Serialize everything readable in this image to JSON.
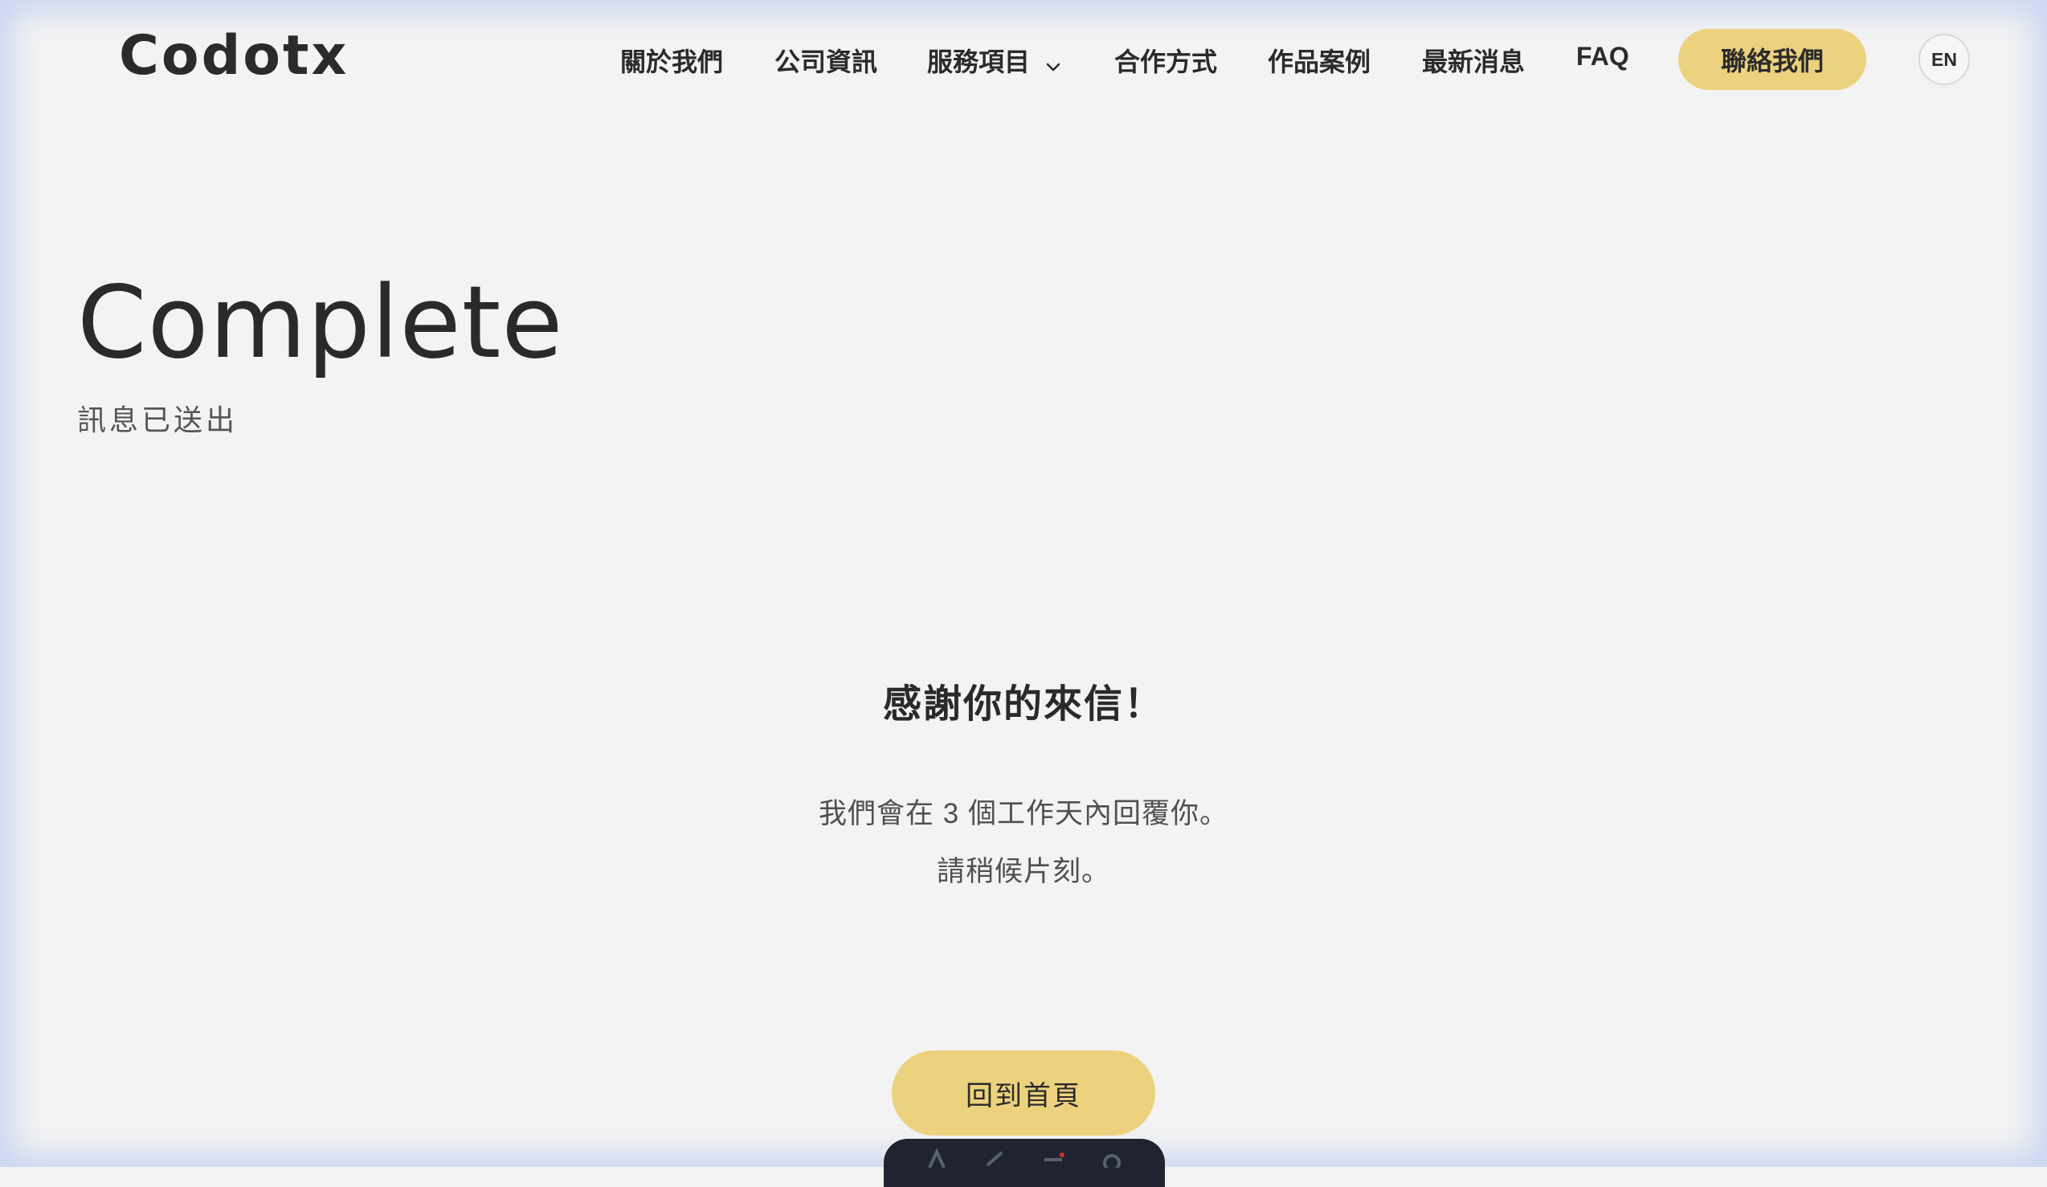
{
  "header": {
    "logo": "Codotx",
    "nav": [
      {
        "label": "關於我們"
      },
      {
        "label": "公司資訊"
      },
      {
        "label": "服務項目",
        "has_dropdown": true
      },
      {
        "label": "合作方式"
      },
      {
        "label": "作品案例"
      },
      {
        "label": "最新消息"
      },
      {
        "label": "FAQ"
      }
    ],
    "contact_label": "聯絡我們",
    "lang_label": "EN"
  },
  "hero": {
    "title": "Complete",
    "subtitle": "訊息已送出"
  },
  "main": {
    "thanks": "感謝你的來信！",
    "line1": "我們會在 3 個工作天內回覆你。",
    "line2": "請稍候片刻。",
    "home_button": "回到首頁"
  },
  "colors": {
    "background": "#f3f3f3",
    "accent": "#ecd27e",
    "text": "#2a2a2a",
    "dock": "#1f2430"
  },
  "icons": {
    "dropdown": "chevron-down-icon"
  }
}
